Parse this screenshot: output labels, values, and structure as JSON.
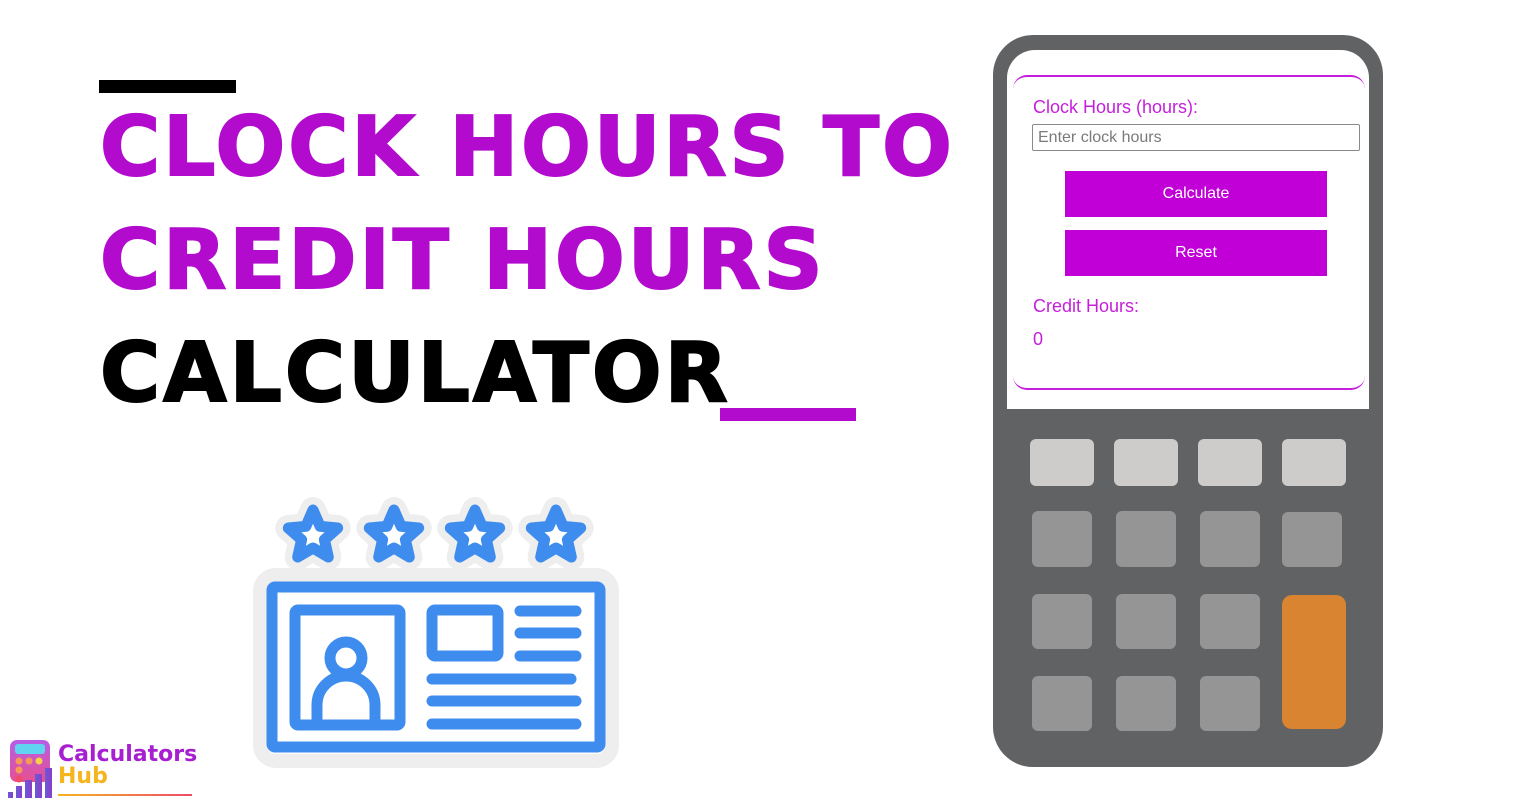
{
  "title": {
    "line1": "CLOCK HOURS TO",
    "line2": "CREDIT HOURS",
    "line3": "CALCULATOR"
  },
  "colors": {
    "accent": "#b20bce",
    "button": "#c000d6",
    "label": "#c51fdc",
    "device_body": "#616264",
    "key_light": "#cdccca",
    "key_dark": "#959595",
    "key_orange": "#d98430",
    "illustration_blue": "#3f8cef"
  },
  "calculator": {
    "input_label": "Clock Hours (hours):",
    "input_placeholder": "Enter clock hours",
    "input_value": "",
    "calculate_label": "Calculate",
    "reset_label": "Reset",
    "result_label": "Credit Hours:",
    "result_value": "0"
  },
  "illustration": {
    "icon": "rating-id-card-icon",
    "star_count": 4
  },
  "logo": {
    "line1": "Calculators",
    "line2": "Hub",
    "icon": "calculator-chart-logo-icon"
  }
}
